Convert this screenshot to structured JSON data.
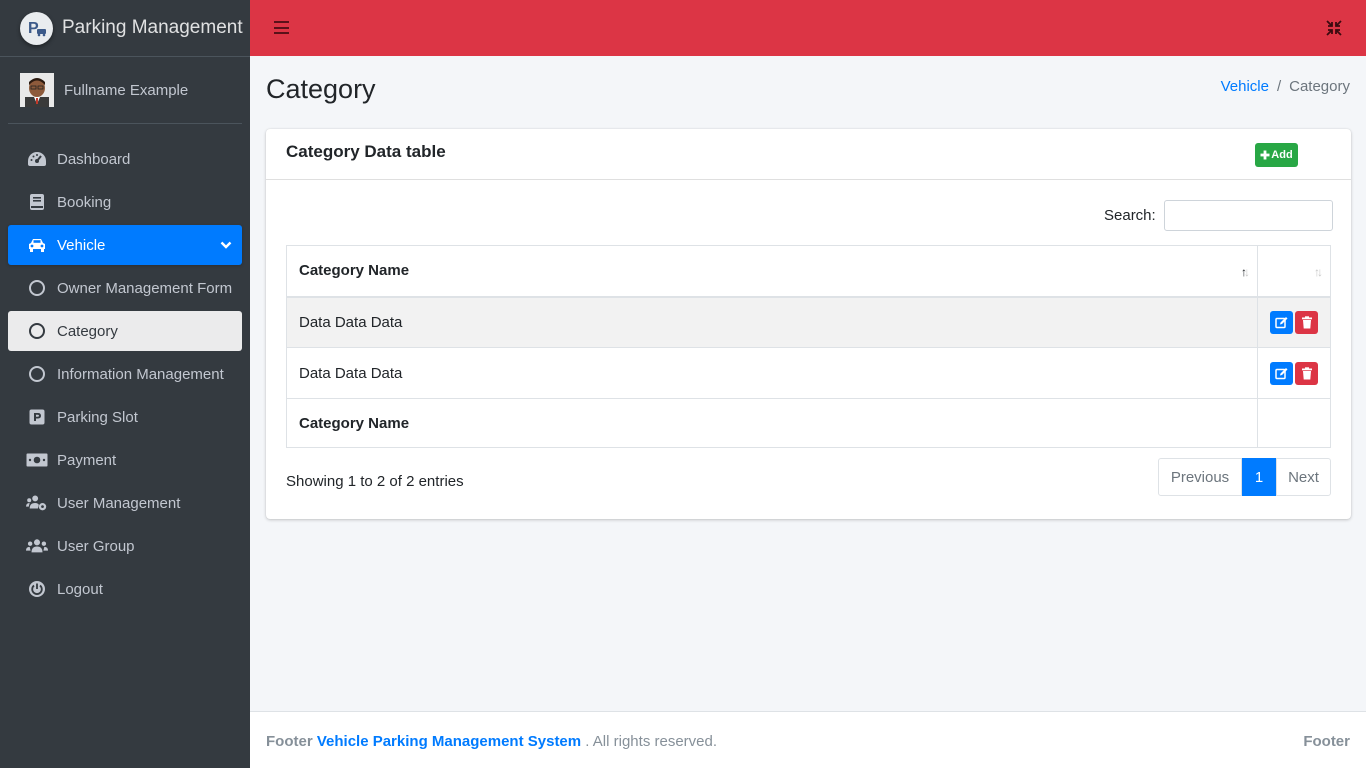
{
  "brand": {
    "title": "Parking Management"
  },
  "user": {
    "name": "Fullname Example"
  },
  "sidebar": {
    "items": [
      {
        "label": "Dashboard",
        "icon": "dashboard-icon"
      },
      {
        "label": "Booking",
        "icon": "book-icon"
      },
      {
        "label": "Vehicle",
        "icon": "car-icon"
      },
      {
        "label": "Owner Management Form",
        "icon": "circle-icon"
      },
      {
        "label": "Category",
        "icon": "circle-icon"
      },
      {
        "label": "Information Management",
        "icon": "circle-icon"
      },
      {
        "label": "Parking Slot",
        "icon": "parking-icon"
      },
      {
        "label": "Payment",
        "icon": "money-icon"
      },
      {
        "label": "User Management",
        "icon": "users-cog-icon"
      },
      {
        "label": "User Group",
        "icon": "users-icon"
      },
      {
        "label": "Logout",
        "icon": "power-icon"
      }
    ]
  },
  "header": {
    "title": "Category",
    "breadcrumb": {
      "parent": "Vehicle",
      "separator": "/",
      "current": "Category"
    }
  },
  "card": {
    "title": "Category Data table",
    "add_label": "Add",
    "search_label": "Search:",
    "search_value": "",
    "columns": [
      "Category Name",
      ""
    ],
    "rows": [
      {
        "name": "Data Data Data"
      },
      {
        "name": "Data Data Data"
      }
    ],
    "footer_column": "Category Name",
    "info": "Showing 1 to 2 of 2 entries",
    "pagination": {
      "previous": "Previous",
      "current": "1",
      "next": "Next"
    }
  },
  "footer": {
    "prefix": "Footer",
    "link": "Vehicle Parking Management System",
    "suffix": ". All rights reserved.",
    "right": "Footer"
  },
  "colors": {
    "topbar": "#dc3545",
    "sidebar": "#343a40",
    "accent": "#007bff",
    "add": "#28a745"
  }
}
